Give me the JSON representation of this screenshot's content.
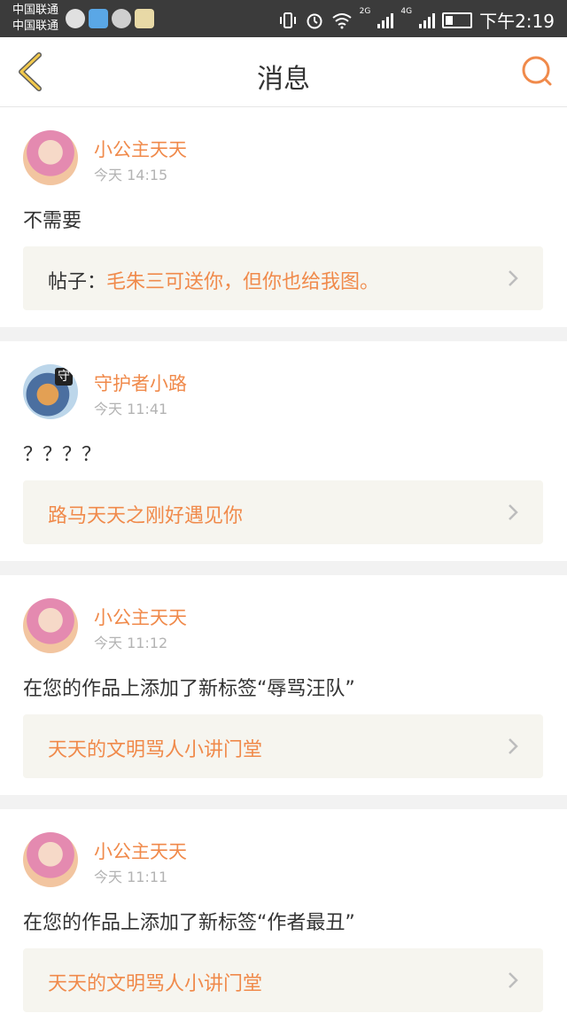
{
  "status_bar": {
    "carrier_1": "中国联通",
    "carrier_2": "中国联通",
    "network_1": "2G",
    "network_2": "4G",
    "time": "下午2:19"
  },
  "nav": {
    "title": "消息",
    "back_icon": "chevron-left-icon",
    "search_icon": "search-icon"
  },
  "accent_color": "#f08a4b",
  "messages": [
    {
      "username": "小公主天天",
      "time": "今天 14:15",
      "text": "不需要",
      "post_prefix": "帖子：",
      "post_title": "毛朱三可送你，但你也给我图。"
    },
    {
      "username": "守护者小路",
      "time": "今天 11:41",
      "text": "？？？？",
      "post_prefix": "",
      "post_title": "路马天天之刚好遇见你",
      "avatar_badge": "守"
    },
    {
      "username": "小公主天天",
      "time": "今天 11:12",
      "text": "在您的作品上添加了新标签“辱骂汪队”",
      "post_prefix": "",
      "post_title": "天天的文明骂人小讲门堂"
    },
    {
      "username": "小公主天天",
      "time": "今天 11:11",
      "text": "在您的作品上添加了新标签“作者最丑”",
      "post_prefix": "",
      "post_title": "天天的文明骂人小讲门堂"
    }
  ]
}
